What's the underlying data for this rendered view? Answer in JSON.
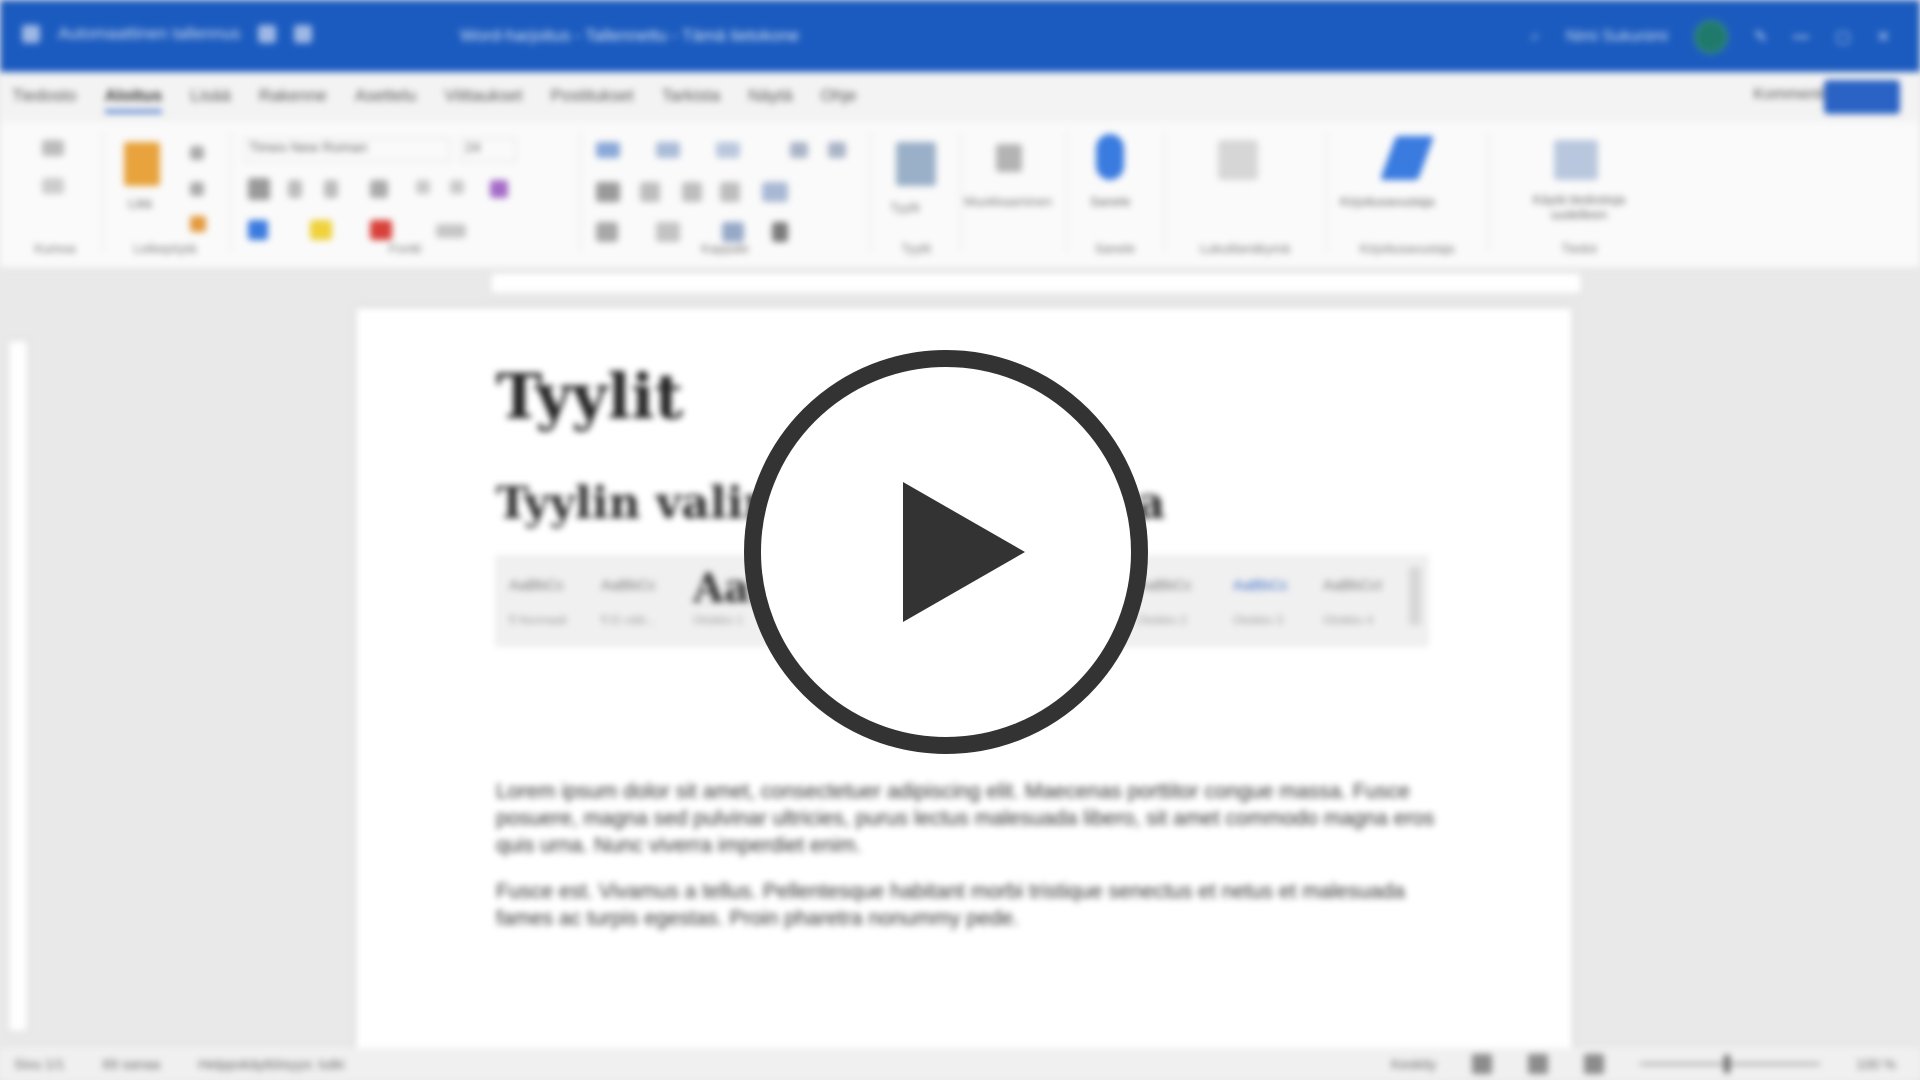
{
  "titlebar": {
    "left_text": "Automaattinen tallennus",
    "center_text": "Word-harjoitus - Tallennettu - Tämä tietokone",
    "user_name": "Nimi Sukunimi"
  },
  "menubar": {
    "tabs": [
      "Tiedosto",
      "Aloitus",
      "Lisää",
      "Rakenne",
      "Asettelu",
      "Viittaukset",
      "Postitukset",
      "Tarkista",
      "Näytä",
      "Ohje"
    ],
    "right_label": "Kommentit"
  },
  "ribbon": {
    "font_name": "Times New Roman",
    "font_size": "24",
    "paste_label": "Liitä",
    "groups": [
      "Kumoa",
      "Leikepöytä",
      "Fontti",
      "Kappale",
      "Tyylit",
      "Muokkaaminen",
      "Sanele",
      "Lukutilanäkymä",
      "Kirjoitusavustaja",
      "Tiedot"
    ],
    "buttons": {
      "styles": "Tyylit",
      "editing": "Muokkaaminen",
      "dictate": "Sanele",
      "editor": "Kirjoitusavustaja",
      "reuse": "Käytä tiedostoja uudelleen"
    }
  },
  "document": {
    "title": "Tyylit",
    "heading": "Tyylin valinta tyylivalikosta",
    "gallery": {
      "items": [
        "AaBbCc",
        "AaBbCc",
        "AaB",
        "AaBbCc",
        "AaBbCc",
        "AaBbCcI"
      ],
      "subs": [
        "¶ Normaali",
        "¶ Ei välii...",
        "Otsikko 1",
        "Otsikko 2",
        "Otsikko 3",
        "Otsikko 4"
      ]
    },
    "para1": "Lorem ipsum dolor sit amet, consectetuer adipiscing elit. Maecenas porttitor congue massa. Fusce posuere, magna sed pulvinar ultricies, purus lectus malesuada libero, sit amet commodo magna eros quis urna. Nunc viverra imperdiet enim.",
    "para2": "Fusce est. Vivamus a tellus. Pellentesque habitant morbi tristique senectus et netus et malesuada fames ac turpis egestas. Proin pharetra nonummy pede."
  },
  "statusbar": {
    "page": "Sivu 1/1",
    "words": "69 sanaa",
    "accessibility": "Helppokäyttöisyys: tutki",
    "focus": "Keskity",
    "zoom": "100 %"
  },
  "colors": {
    "titlebar": "#1b5bbf",
    "accent": "#2b63c5",
    "play_ring": "#333333"
  },
  "overlay": {
    "icon": "play-icon"
  }
}
